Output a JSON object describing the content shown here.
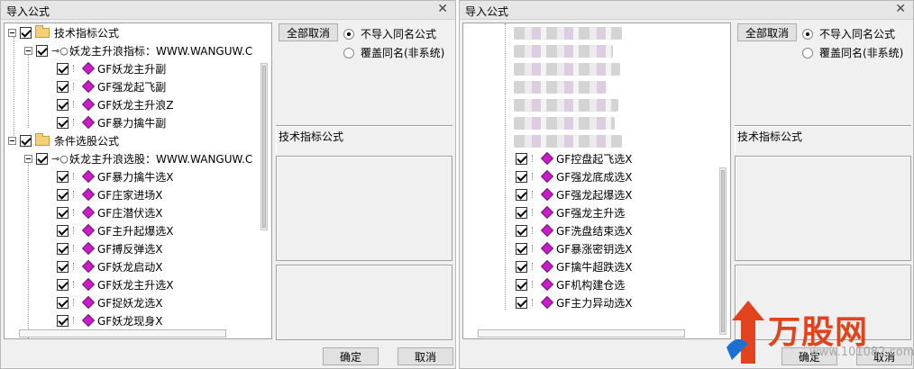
{
  "left": {
    "title": "导入公式",
    "close_glyph": "✕",
    "tree": {
      "group1": {
        "label": "技术指标公式",
        "parent": "妖龙主升浪指标：WWW.WANGUW.C",
        "items": [
          "GF妖龙主升副",
          "GF强龙起飞副",
          "GF妖龙主升浪Z",
          "GF暴力擒牛副"
        ]
      },
      "group2": {
        "label": "条件选股公式",
        "parent": "妖龙主升浪选股：WWW.WANGUW.C",
        "items": [
          "GF暴力擒牛选X",
          "GF庄家进场X",
          "GF庄潜伏选X",
          "GF主升起爆选X",
          "GF搏反弹选X",
          "GF妖龙启动X",
          "GF妖龙主升选X",
          "GF捉妖龙选X",
          "GF妖龙现身X"
        ]
      }
    },
    "buttons": {
      "select_all": "全部取消",
      "ok": "确定",
      "cancel": "取消"
    },
    "options": {
      "no_import": "不导入同名公式",
      "overwrite": "覆盖同名(非系统)"
    },
    "section_label": "技术指标公式"
  },
  "right": {
    "title": "导入公式",
    "close_glyph": "✕",
    "tree": {
      "items": [
        "GF控盘起飞选X",
        "GF强龙底成选X",
        "GF强龙起爆选X",
        "GF强龙主升选",
        "GF洗盘结束选X",
        "GF暴涨密钥选X",
        "GF擒牛超跌选X",
        "GF机构建仓选",
        "GF主力异动选X"
      ]
    },
    "buttons": {
      "select_all": "全部取消",
      "ok": "确定",
      "cancel": "取消"
    },
    "options": {
      "no_import": "不导入同名公式",
      "overwrite": "覆盖同名(非系统)"
    },
    "section_label": "技术指标公式"
  },
  "watermark": {
    "brand": "万股网",
    "site": "www.101082.com"
  },
  "colors": {
    "gem": "#c81ec8",
    "brand": "#e1431d",
    "folder": "#f3cf7a"
  }
}
